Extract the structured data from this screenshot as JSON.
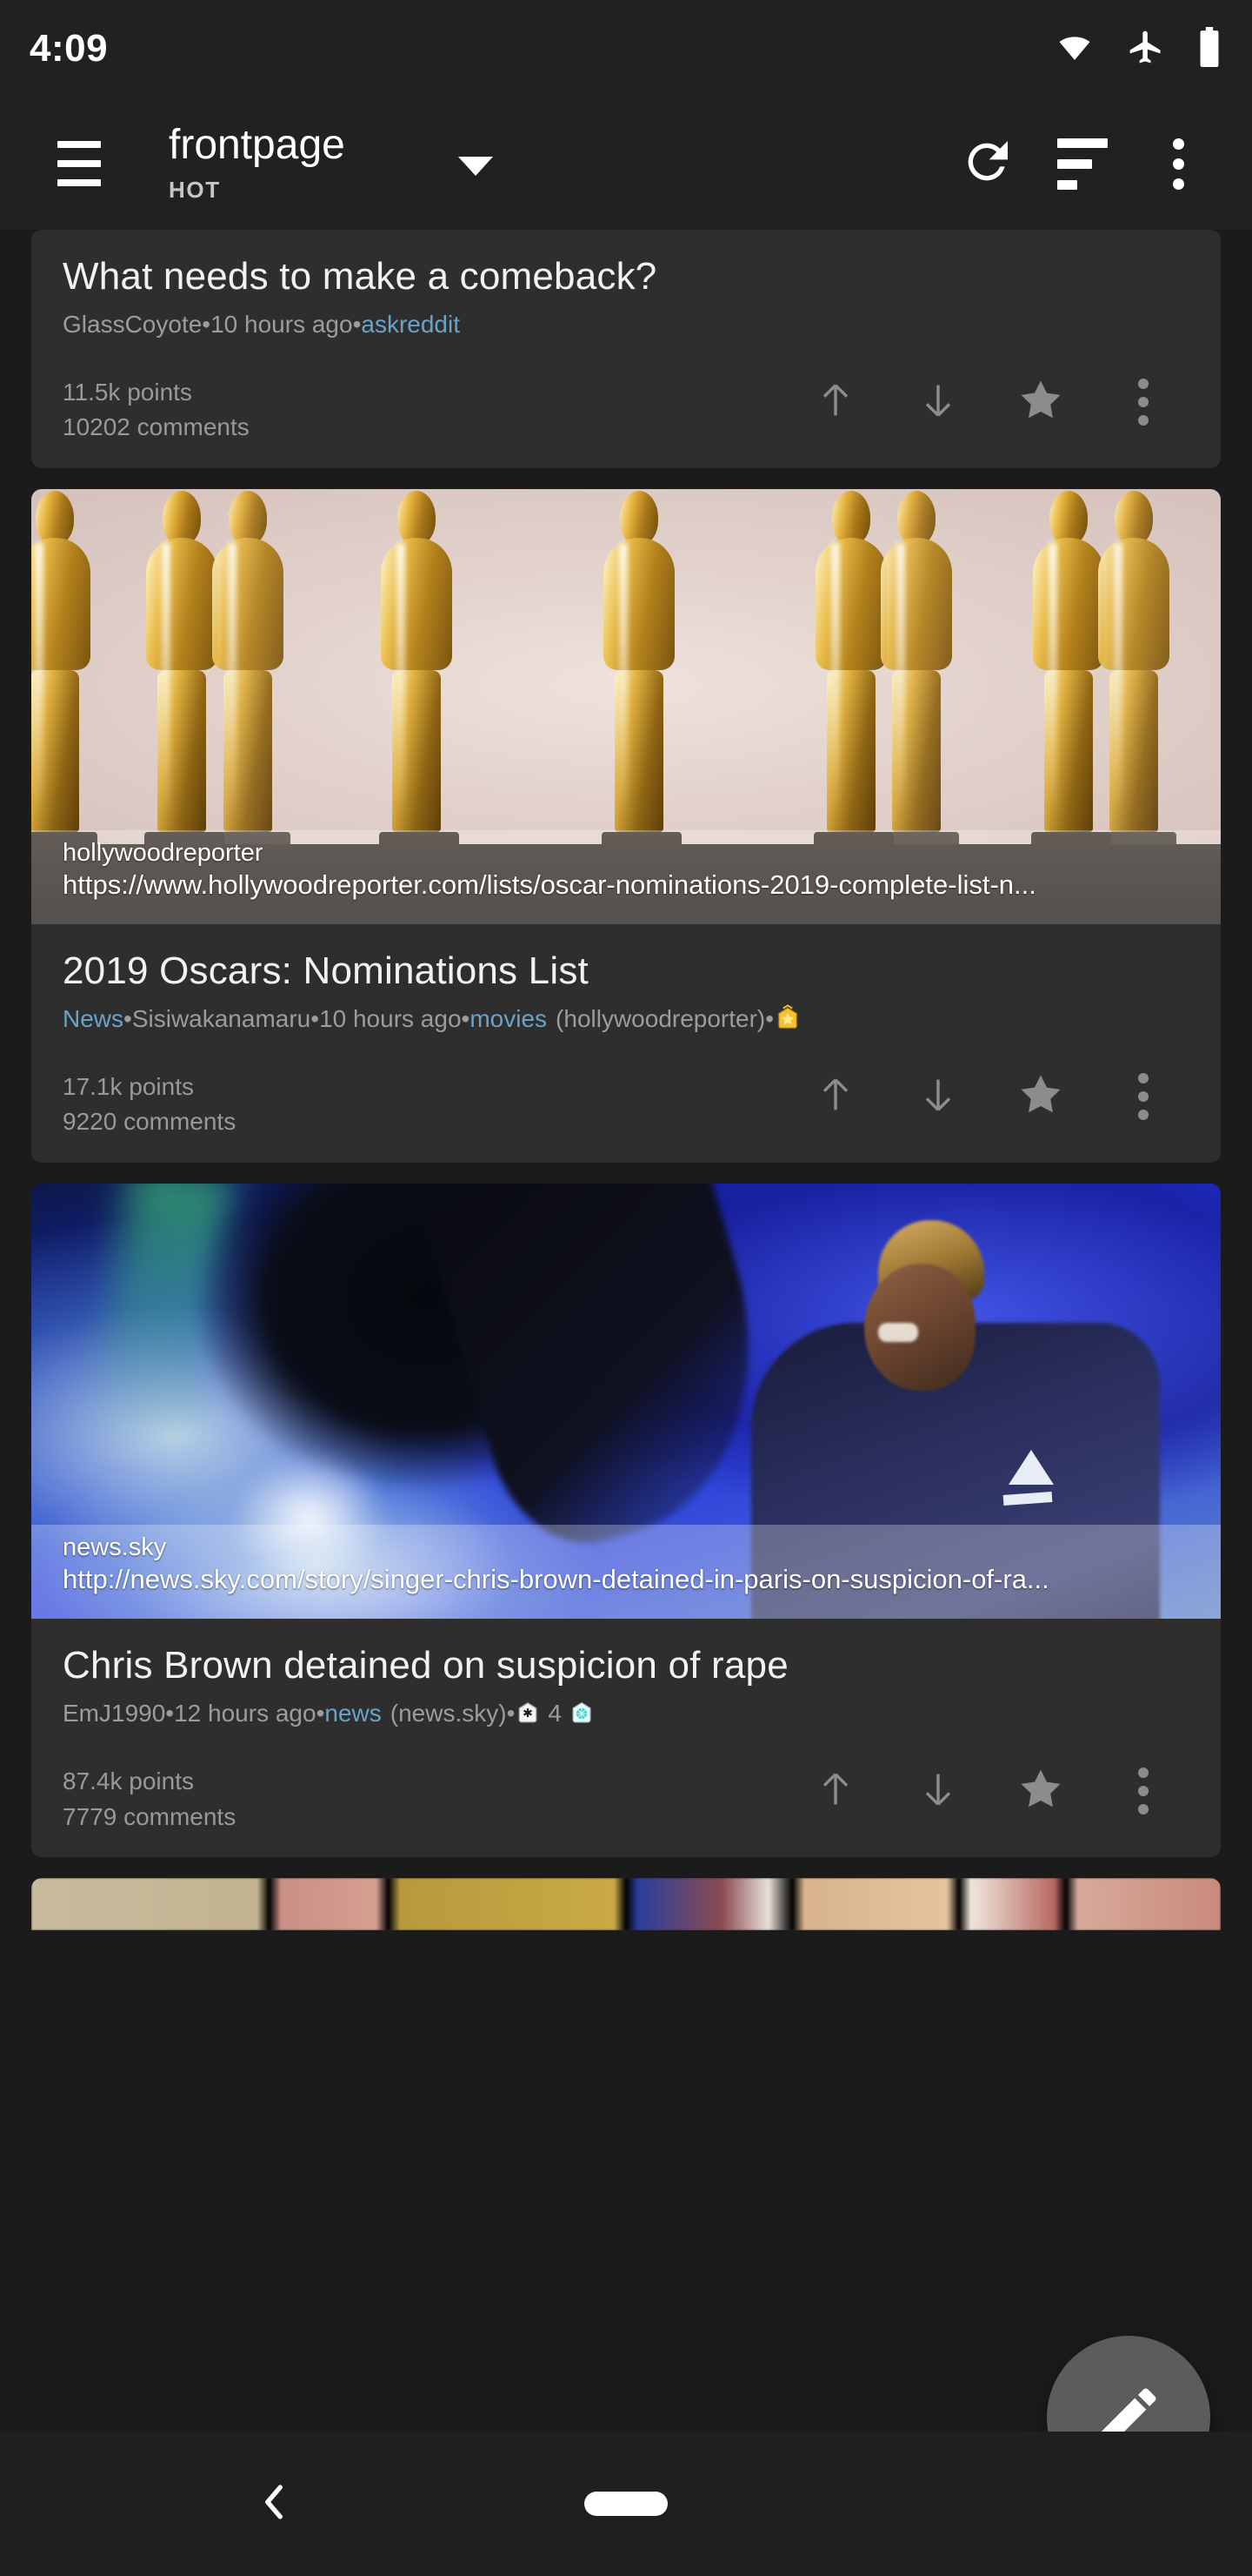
{
  "statusbar": {
    "clock": "4:09",
    "icons": [
      "wifi-icon",
      "airplane-mode-icon",
      "battery-icon"
    ]
  },
  "appbar": {
    "menu_icon": "hamburger-menu-icon",
    "title": "frontpage",
    "subtitle": "HOT",
    "dropdown_icon": "chevron-down-icon",
    "actions": [
      {
        "name": "refresh-button",
        "icon": "refresh-icon"
      },
      {
        "name": "sort-button",
        "icon": "sort-icon"
      },
      {
        "name": "overflow-menu-button",
        "icon": "more-vertical-icon"
      }
    ]
  },
  "colors": {
    "page_background": "#1b1b1b",
    "card_background": "#2e2e2e",
    "appbar_background": "#212121",
    "link_blue": "#6aa3c8",
    "muted_text": "#9c9c9c",
    "fab_background": "#5c5c5c"
  },
  "posts": [
    {
      "title": "What needs to make a comeback?",
      "flair": "",
      "author": "GlassCoyote",
      "age": "10 hours ago",
      "subreddit": "askreddit",
      "domain": "",
      "points": "11.5k points",
      "comments": "10202 comments",
      "has_media": false,
      "awards": [],
      "sep": " • "
    },
    {
      "title": "2019 Oscars: Nominations List",
      "flair": "News",
      "author": "Sisiwakanamaru",
      "age": "10 hours ago",
      "subreddit": "movies",
      "domain": "(hollywoodreporter)",
      "points": "17.1k points",
      "comments": "9220 comments",
      "has_media": true,
      "media_kind": "oscars-statuettes-photo",
      "url_domain": "hollywoodreporter",
      "url_full": "https://www.hollywoodreporter.com/lists/oscar-nominations-2019-complete-list-n...",
      "awards": [
        {
          "name": "gold-award-icon",
          "count": ""
        }
      ],
      "sep": " • "
    },
    {
      "title": "Chris Brown detained on suspicion of rape",
      "flair": "",
      "author": "EmJ1990",
      "age": "12 hours ago",
      "subreddit": "news",
      "domain": "(news.sky)",
      "points": "87.4k points",
      "comments": "7779 comments",
      "has_media": true,
      "media_kind": "chris-brown-concert-photo",
      "url_domain": "news.sky",
      "url_full": "http://news.sky.com/story/singer-chris-brown-detained-in-paris-on-suspicion-of-ra...",
      "awards": [
        {
          "name": "silver-award-icon",
          "count": "4"
        },
        {
          "name": "teal-award-icon",
          "count": ""
        }
      ],
      "sep": " • "
    }
  ],
  "post_actions": [
    {
      "name": "upvote-button",
      "icon": "arrow-up-icon"
    },
    {
      "name": "downvote-button",
      "icon": "arrow-down-icon"
    },
    {
      "name": "save-button",
      "icon": "star-icon"
    },
    {
      "name": "post-overflow-button",
      "icon": "more-vertical-icon"
    }
  ],
  "fab": {
    "name": "compose-fab",
    "icon": "pencil-edit-icon"
  },
  "navbar": {
    "back": {
      "name": "nav-back-button",
      "icon": "chevron-left-icon"
    },
    "home": {
      "name": "nav-home-pill",
      "icon": "home-pill-icon"
    }
  }
}
